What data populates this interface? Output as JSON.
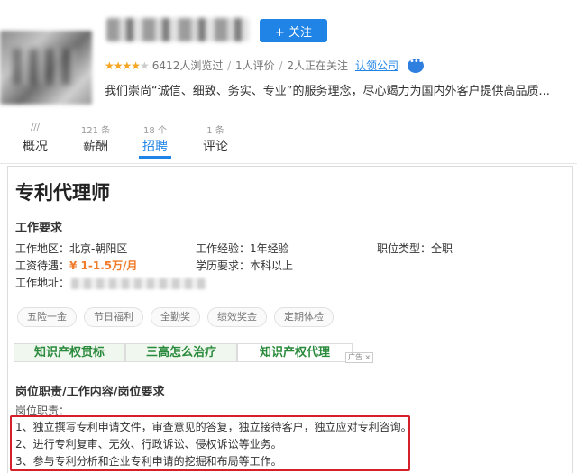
{
  "header": {
    "follow_label": "+ 关注",
    "rating_stars": 4,
    "meta": {
      "views": "6412人浏览过",
      "reviews": "1人评价",
      "followers": "2人正在关注",
      "claim": "认领公司"
    },
    "slogan": "我们崇尚“诚信、细致、务实、专业”的服务理念，尽心竭力为国内外客户提供高品质..."
  },
  "tabs": [
    {
      "count": "///",
      "label": "概况"
    },
    {
      "count": "121 条",
      "label": "薪酬"
    },
    {
      "count": "18 个",
      "label": "招聘"
    },
    {
      "count": "1 条",
      "label": "评论"
    }
  ],
  "job": {
    "title": "专利代理师",
    "requirements_heading": "工作要求",
    "area": "工作地区：北京-朝阳区",
    "experience": "工作经验：1年经验",
    "job_type": "职位类型：全职",
    "salary_label": "工资待遇：",
    "salary_value": "¥ 1-1.5万/月",
    "education": "学历要求：本科以上",
    "address_label": "工作地址："
  },
  "tags": [
    "五险一金",
    "节日福利",
    "全勤奖",
    "绩效奖金",
    "定期体检"
  ],
  "ads": [
    "知识产权贯标",
    "三高怎么治疗",
    "知识产权代理"
  ],
  "ad_badge": "广告 ×",
  "duties": {
    "heading": "岗位职责/工作内容/岗位要求",
    "subheading": "岗位职责：",
    "items": [
      "1、独立撰写专利申请文件，审查意见的答复，独立接待客户，独立应对专利咨询。",
      "2、进行专利复审、无效、行政诉讼、侵权诉讼等业务。",
      "3、参与专利分析和企业专利申请的挖掘和布局等工作。"
    ]
  },
  "colors": {
    "accent": "#1f84e6",
    "salary": "#f07b2b",
    "star": "#f5a623",
    "highlight_box": "#d3202a",
    "ad_text": "#2a8a3c"
  }
}
